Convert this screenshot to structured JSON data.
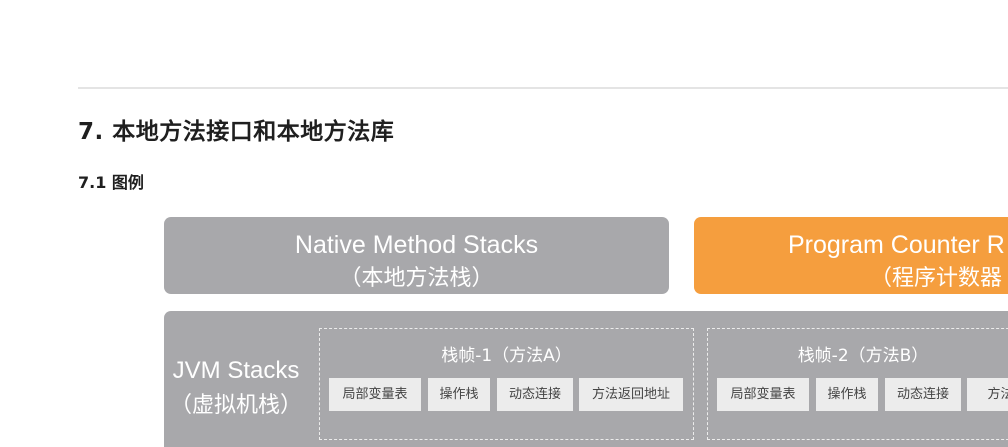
{
  "heading": "7. 本地方法接口和本地方法库",
  "subheading": "7.1 图例",
  "diagram": {
    "native_stacks": {
      "title": "Native Method Stacks",
      "subtitle": "（本地方法栈）"
    },
    "pc_register": {
      "title": "Program Counter R",
      "subtitle": "（程序计数器"
    },
    "jvm_stacks": {
      "title": "JVM Stacks",
      "subtitle": "（虚拟机栈）",
      "frames": [
        {
          "title": "栈帧-1（方法A）",
          "cells": [
            "局部变量表",
            "操作栈",
            "动态连接",
            "方法返回地址"
          ]
        },
        {
          "title": "栈帧-2（方法B）",
          "cells": [
            "局部变量表",
            "操作栈",
            "动态连接",
            "方法返"
          ]
        }
      ]
    }
  },
  "colors": {
    "gray_box": "#a8a8ab",
    "orange_box": "#f59e3e",
    "cell_bg": "#ececec"
  }
}
